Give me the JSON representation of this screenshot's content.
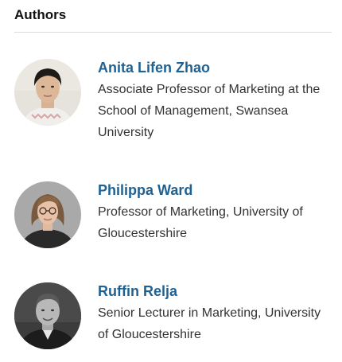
{
  "section": {
    "title": "Authors"
  },
  "authors": [
    {
      "name": "Anita Lifen Zhao",
      "role": "Associate Professor of Marketing at the School of Management, Swansea University",
      "avatar": "author-photo"
    },
    {
      "name": "Philippa Ward",
      "role": "Professor of Marketing, University of Gloucestershire",
      "avatar": "author-photo"
    },
    {
      "name": "Ruffin Relja",
      "role": "Senior Lecturer in Marketing, University of Gloucestershire",
      "avatar": "author-photo"
    }
  ],
  "colors": {
    "name_link": "#1f6193",
    "role_text": "#333333",
    "title_text": "#111111",
    "divider": "#dcdcdc"
  }
}
